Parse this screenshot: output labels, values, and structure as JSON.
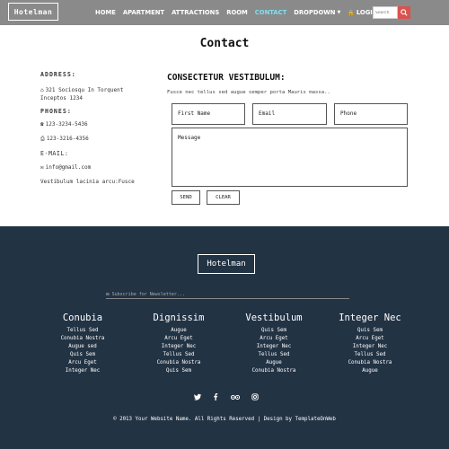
{
  "header": {
    "logo": "Hotelman",
    "nav": [
      {
        "label": "HOME"
      },
      {
        "label": "APARTMENT"
      },
      {
        "label": "ATTRACTIONS"
      },
      {
        "label": "ROOM"
      },
      {
        "label": "CONTACT",
        "active": true
      },
      {
        "label": "DROPDOWN"
      },
      {
        "label": "LOGIN"
      }
    ],
    "search_placeholder": "Search"
  },
  "page": {
    "title": "Contact"
  },
  "contact_info": {
    "address_label": "ADDRESS:",
    "address_line1": "321 Sociosqu In Torquent",
    "address_line2": "Inceptos 1234",
    "phones_label": "PHONES:",
    "phone": "123-3234-5436",
    "fax": "123-3216-4356",
    "email_label": "E-MAIL:",
    "email": "info@gmail.com",
    "note": "Vestibulum lacinia arcu:Fusce"
  },
  "form": {
    "title": "CONSECTETUR VESTIBULUM:",
    "text": "Fusce nec tellus sed augue semper porta Mauris massa..",
    "first_name_placeholder": "First Name",
    "email_placeholder": "Email",
    "phone_placeholder": "Phone",
    "message_placeholder": "Message",
    "send_label": "SEND",
    "clear_label": "CLEAR"
  },
  "footer": {
    "logo": "Hotelman",
    "newsletter_placeholder": "Subscribe for Newsletter...",
    "columns": [
      {
        "heading": "Conubia",
        "items": [
          "Tellus Sed",
          "Conubia Nostra",
          "Augue sed",
          "Quis Sem",
          "Arcu Eget",
          "Integer Nec"
        ]
      },
      {
        "heading": "Dignissim",
        "items": [
          "Augue",
          "Arcu Eget",
          "Integer Nec",
          "Tellus Sed",
          "Conubia Nostra",
          "Quis Sem"
        ]
      },
      {
        "heading": "Vestibulum",
        "items": [
          "Quis Sem",
          "Arcu Eget",
          "Integer Nec",
          "Tellus Sed",
          "Augue",
          "Conubia Nostra"
        ]
      },
      {
        "heading": "Integer Nec",
        "items": [
          "Quis Sem",
          "Arcu Eget",
          "Integer Nec",
          "Tellus Sed",
          "Conubia Nostra",
          "Augue"
        ]
      }
    ],
    "social_icons": [
      "twitter-icon",
      "facebook-icon",
      "tripadvisor-icon",
      "instagram-icon"
    ],
    "copyright": "© 2013 Your Website Name. All Rights Reserved | Design by TemplateOnWeb"
  },
  "colors": {
    "header_bg": "#8a8a8a",
    "active_nav": "#7fe0f0",
    "search_button": "#d9534f",
    "footer_bg": "#223344"
  }
}
